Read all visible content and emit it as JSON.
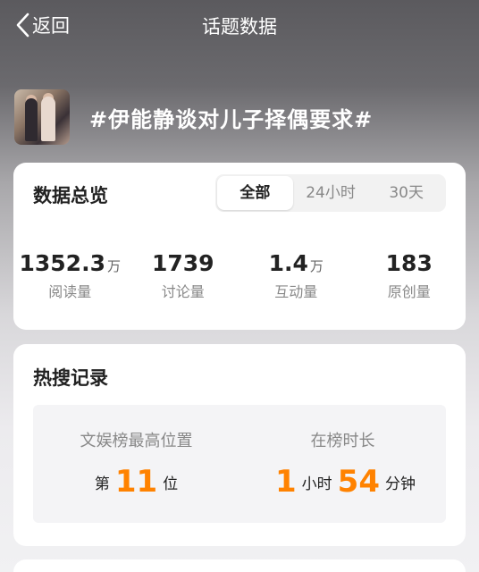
{
  "nav": {
    "back_label": "返回",
    "title": "话题数据"
  },
  "topic": {
    "title": "#伊能静谈对儿子择偶要求#"
  },
  "overview": {
    "title": "数据总览",
    "tabs": [
      {
        "label": "全部",
        "active": true
      },
      {
        "label": "24小时",
        "active": false
      },
      {
        "label": "30天",
        "active": false
      }
    ],
    "stats": [
      {
        "value": "1352.3",
        "unit": "万",
        "label": "阅读量"
      },
      {
        "value": "1739",
        "unit": "",
        "label": "讨论量"
      },
      {
        "value": "1.4",
        "unit": "万",
        "label": "互动量"
      },
      {
        "value": "183",
        "unit": "",
        "label": "原创量"
      }
    ]
  },
  "hot": {
    "title": "热搜记录",
    "rank": {
      "label": "文娱榜最高位置",
      "prefix": "第",
      "value": "11",
      "suffix": "位"
    },
    "duration": {
      "label": "在榜时长",
      "hours": "1",
      "hours_unit": "小时",
      "minutes": "54",
      "minutes_unit": "分钟"
    }
  },
  "colors": {
    "accent": "#ff8200"
  }
}
